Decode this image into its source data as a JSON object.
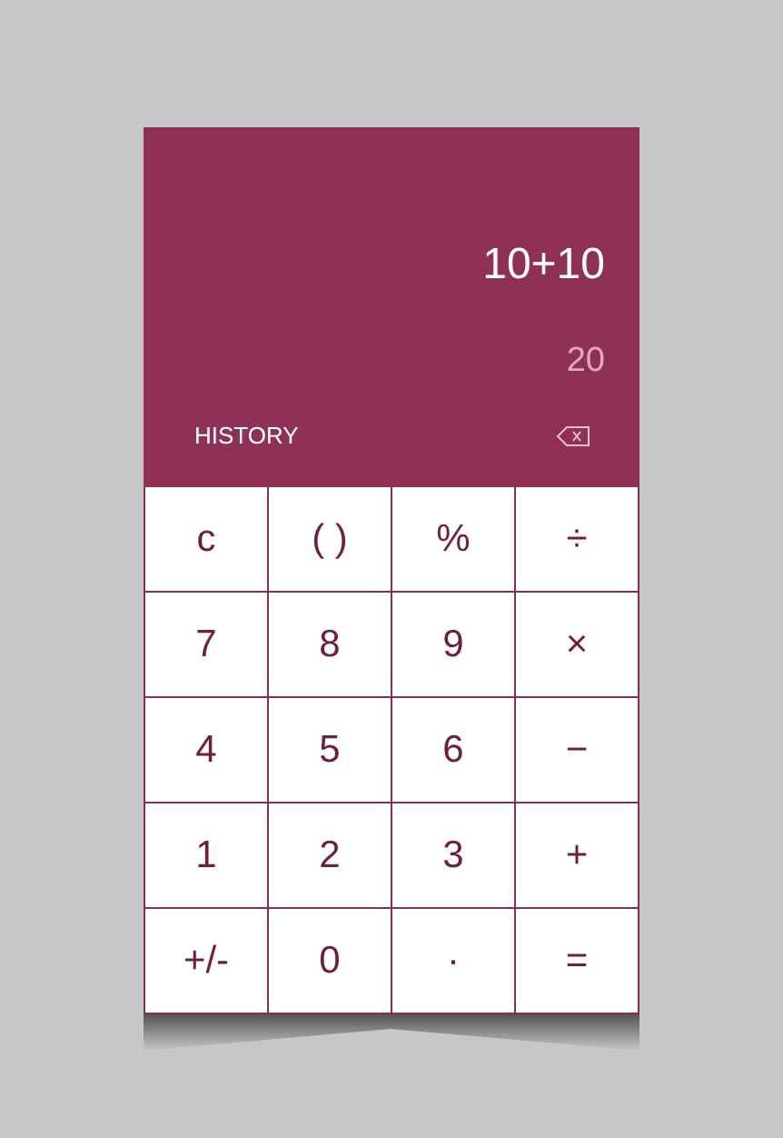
{
  "display": {
    "expression": "10+10",
    "result": "20",
    "history_label": "HISTORY"
  },
  "keypad": [
    [
      "c",
      "( )",
      "%",
      "÷"
    ],
    [
      "7",
      "8",
      "9",
      "×"
    ],
    [
      "4",
      "5",
      "6",
      "−"
    ],
    [
      "1",
      "2",
      "3",
      "+"
    ],
    [
      "+/-",
      "0",
      "·",
      "="
    ]
  ]
}
